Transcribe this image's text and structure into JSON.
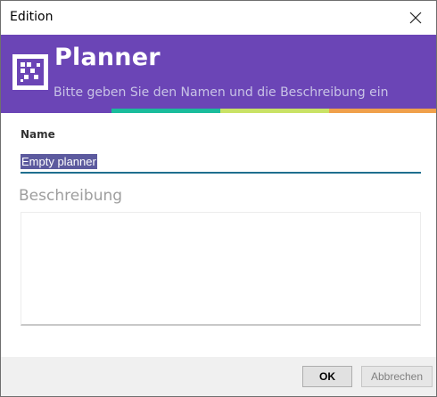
{
  "window": {
    "title": "Edition"
  },
  "header": {
    "app_name": "Planner",
    "subtitle": "Bitte geben Sie den Namen und die Beschreibung ein",
    "background_color": "#6b45b6",
    "stripe_colors": [
      "#6b45b6",
      "#1abc9c",
      "#c9e265",
      "#f0a04b"
    ]
  },
  "form": {
    "name_label": "Name",
    "name_value": "Empty planner",
    "description_label": "Beschreibung",
    "description_value": ""
  },
  "footer": {
    "ok_label": "OK",
    "cancel_label": "Abbrechen"
  }
}
